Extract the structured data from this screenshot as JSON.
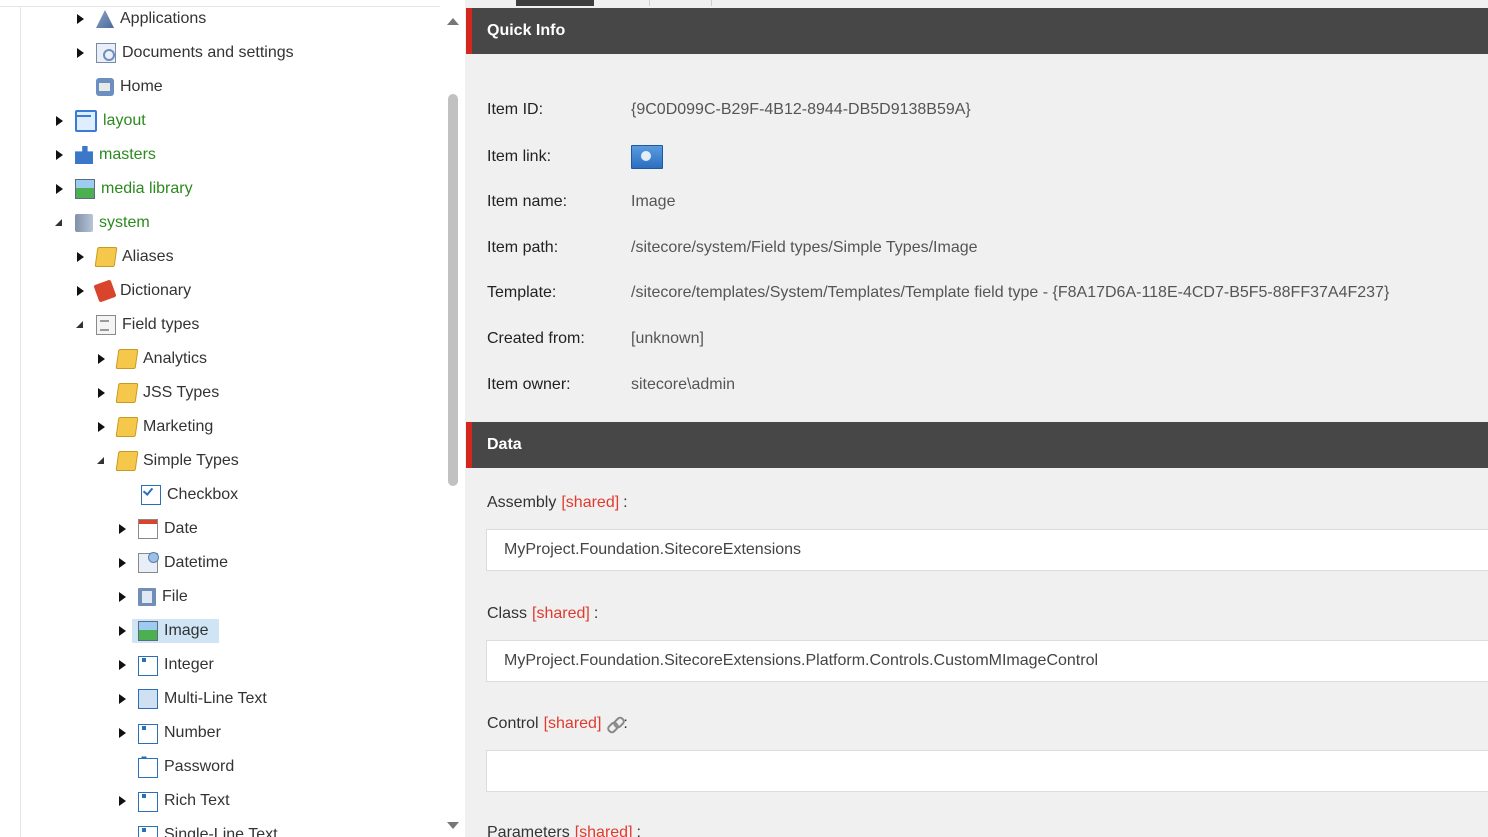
{
  "tree": {
    "nodes": [
      {
        "label": "Applications"
      },
      {
        "label": "Documents and settings"
      },
      {
        "label": "Home"
      },
      {
        "label": "layout"
      },
      {
        "label": "masters"
      },
      {
        "label": "media library"
      },
      {
        "label": "system"
      },
      {
        "label": "Aliases"
      },
      {
        "label": "Dictionary"
      },
      {
        "label": "Field types"
      },
      {
        "label": "Analytics"
      },
      {
        "label": "JSS Types"
      },
      {
        "label": "Marketing"
      },
      {
        "label": "Simple Types"
      },
      {
        "label": "Checkbox"
      },
      {
        "label": "Date"
      },
      {
        "label": "Datetime"
      },
      {
        "label": "File"
      },
      {
        "label": "Image"
      },
      {
        "label": "Integer"
      },
      {
        "label": "Multi-Line Text"
      },
      {
        "label": "Number"
      },
      {
        "label": "Password"
      },
      {
        "label": "Rich Text"
      },
      {
        "label": "Single-Line Text"
      }
    ]
  },
  "quick_info": {
    "title": "Quick Info",
    "item_id_label": "Item ID:",
    "item_id": "{9C0D099C-B29F-4B12-8944-DB5D9138B59A}",
    "item_link_label": "Item link:",
    "item_name_label": "Item name:",
    "item_name": "Image",
    "item_path_label": "Item path:",
    "item_path": "/sitecore/system/Field types/Simple Types/Image",
    "template_label": "Template:",
    "template": "/sitecore/templates/System/Templates/Template field type - {F8A17D6A-118E-4CD7-B5F5-88FF37A4F237}",
    "created_from_label": "Created from:",
    "created_from": "[unknown]",
    "item_owner_label": "Item owner:",
    "item_owner": "sitecore\\admin"
  },
  "data_section": {
    "title": "Data",
    "shared_tag": "[shared]",
    "colon": ":",
    "assembly_label": "Assembly",
    "assembly_value": "MyProject.Foundation.SitecoreExtensions",
    "class_label": "Class",
    "class_value": "MyProject.Foundation.SitecoreExtensions.Platform.Controls.CustomMImageControl",
    "control_label": "Control",
    "control_value": "",
    "parameters_label": "Parameters"
  },
  "colors": {
    "header_bg": "#474747",
    "accent_red": "#d3261c",
    "tree_green": "#2b8a1e",
    "selected_bg": "#cfe5f5"
  }
}
